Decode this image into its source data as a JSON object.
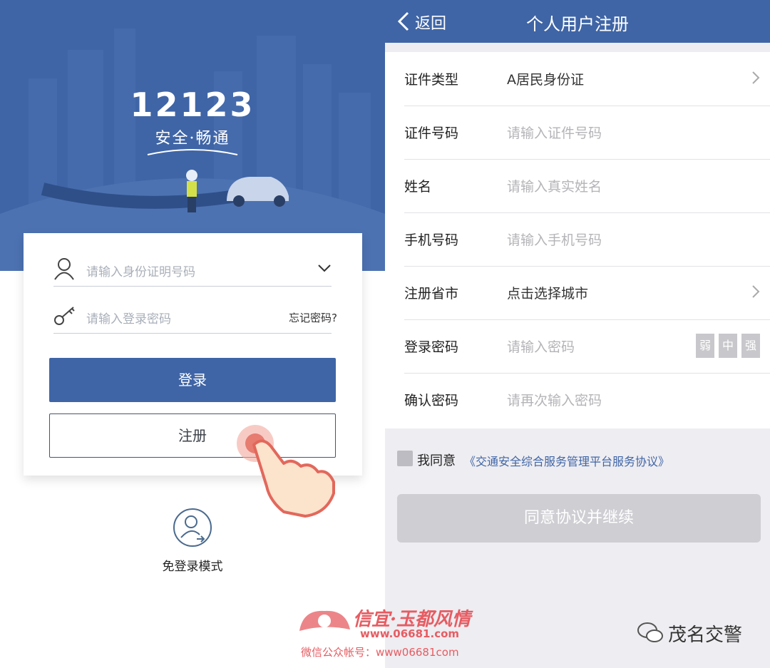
{
  "login": {
    "logo": "12123",
    "slogan": "安全·畅通",
    "id_placeholder": "请输入身份证明号码",
    "password_placeholder": "请输入登录密码",
    "forgot_password": "忘记密码?",
    "login_button": "登录",
    "register_button": "注册",
    "guest_mode": "免登录模式"
  },
  "register": {
    "back": "返回",
    "title": "个人用户注册",
    "rows": [
      {
        "label": "证件类型",
        "value": "A居民身份证"
      },
      {
        "label": "证件号码",
        "placeholder": "请输入证件号码"
      },
      {
        "label": "姓名",
        "placeholder": "请输入真实姓名"
      },
      {
        "label": "手机号码",
        "placeholder": "请输入手机号码"
      },
      {
        "label": "注册省市",
        "value": "点击选择城市"
      },
      {
        "label": "登录密码",
        "placeholder": "请输入密码"
      },
      {
        "label": "确认密码",
        "placeholder": "请再次输入密码"
      }
    ],
    "strength": [
      "弱",
      "中",
      "强"
    ],
    "agree_label": "我同意",
    "agreement_link": "《交通安全综合服务管理平台服务协议》",
    "continue_button": "同意协议并继续"
  },
  "watermark": {
    "site_name": "信宜·玉都风情",
    "site_url": "www.06681.com",
    "account": "微信公众帐号：www06681com",
    "wechat_name": "茂名交警"
  },
  "colors": {
    "brand_blue": "#3f65a6",
    "disabled_gray": "#cfced3",
    "watermark_red": "#e65c62"
  }
}
